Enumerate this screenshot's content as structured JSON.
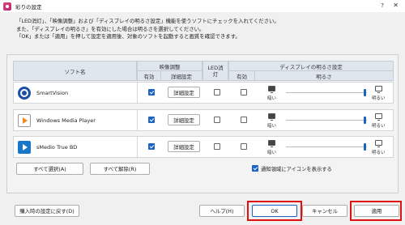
{
  "window": {
    "title": "彩りの設定",
    "help": "?",
    "close": "✕"
  },
  "instructions": [
    "「LED消灯」、「映像調整」および「ディスプレイの明るさ設定」機能を使うソフトにチェックを入れてください。",
    "また、「ディスプレイの明るさ」を有効にした場合は明るさを選択してください。",
    "「OK」または「適用」を押して設定を適用後、対象のソフトを起動すると画質を確認できます。"
  ],
  "table": {
    "col_software": "ソフト名",
    "col_video": "映像調整",
    "col_enabled": "有効",
    "col_detail": "詳細設定",
    "col_led": "LED消灯",
    "col_display": "ディスプレイの明るさ設定",
    "col_enabled2": "有効",
    "col_brightness": "明るさ",
    "rows": [
      {
        "name": "SmartVision",
        "icon": "smartvision-icon",
        "video_enabled": true,
        "detail_label": "詳細設定",
        "led_off": false,
        "bright_enabled": false,
        "dark_label": "暗い",
        "light_label": "明るい",
        "brightness": 1.0
      },
      {
        "name": "Windows Media Player",
        "icon": "windows-media-player-icon",
        "video_enabled": true,
        "detail_label": "詳細設定",
        "led_off": false,
        "bright_enabled": false,
        "dark_label": "暗い",
        "light_label": "明るい",
        "brightness": 1.0
      },
      {
        "name": "sMedio True BD",
        "icon": "smedio-icon",
        "video_enabled": true,
        "detail_label": "詳細設定",
        "led_off": false,
        "bright_enabled": false,
        "dark_label": "暗い",
        "light_label": "明るい",
        "brightness": 1.0
      }
    ]
  },
  "buttons": {
    "select_all": "すべて選択(A)",
    "deselect_all": "すべて解除(R)",
    "restore": "購入時の設定に戻す(D)",
    "help": "ヘルプ(H)",
    "ok": "OK",
    "cancel": "キャンセル",
    "apply": "適用"
  },
  "notify": {
    "checked": true,
    "label": "通知領域にアイコンを表示する"
  },
  "colors": {
    "accent": "#1a62c4",
    "highlight": "#e01010",
    "header_bg": "#dfe6ee"
  }
}
